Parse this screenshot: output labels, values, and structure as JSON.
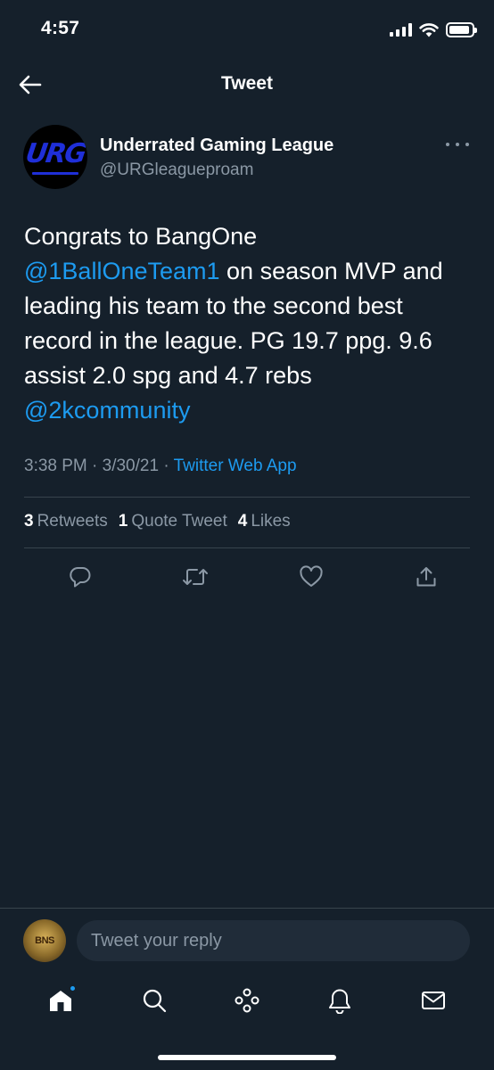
{
  "status_bar": {
    "time": "4:57"
  },
  "header": {
    "title": "Tweet"
  },
  "author": {
    "name": "Underrated Gaming League",
    "handle": "@URGleagueproam",
    "avatar_text": "URG",
    "avatar_color": "#1f2fd8"
  },
  "tweet": {
    "text_line1": "Congrats to BangOne",
    "mention1": "@1BallOneTeam1",
    "text_line2_rest": " on season MVP and",
    "text_line3": "leading his team to the second best",
    "text_line4": "record in the league. PG 19.7 ppg. 9.6",
    "text_line5": "assist 2.0 spg and 4.7 rebs",
    "mention2": "@2kcommunity",
    "timestamp": "3:38 PM · 3/30/21 · ",
    "source": "Twitter Web App"
  },
  "stats": {
    "retweets_count": "3",
    "retweets_label": "Retweets",
    "quotes_count": "1",
    "quotes_label": "Quote Tweet",
    "likes_count": "4",
    "likes_label": "Likes"
  },
  "reply": {
    "placeholder": "Tweet your reply",
    "avatar_text": "BNS"
  },
  "colors": {
    "background": "#15202b",
    "accent": "#1d9bf0",
    "secondary_text": "#8b98a5",
    "divider": "#38444d"
  },
  "icons": {
    "back": "arrow-left-icon",
    "more": "more-horizontal-icon",
    "reply": "reply-icon",
    "retweet": "retweet-icon",
    "like": "heart-icon",
    "share": "share-icon",
    "home": "home-icon",
    "search": "search-icon",
    "spaces": "spaces-icon",
    "notifications": "bell-icon",
    "messages": "mail-icon"
  }
}
